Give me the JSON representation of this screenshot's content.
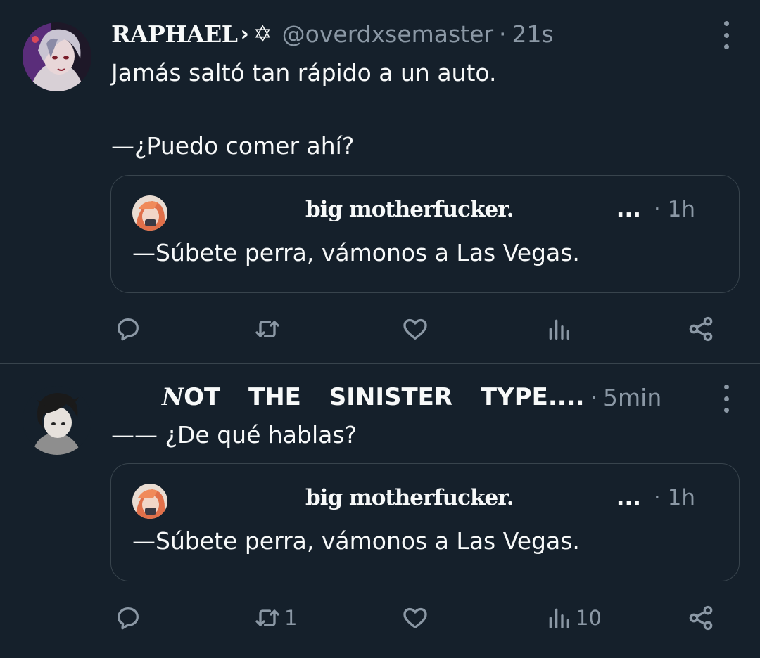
{
  "tweets": [
    {
      "author_name": "RAPHAEL",
      "author_chevron": "›",
      "author_symbol": "✡",
      "handle": "@overdxsemaster",
      "separator": "·",
      "time": "21s",
      "text": "Jamás saltó tan rápido a un auto.\n\n—¿Puedo comer ahí?",
      "quote": {
        "author_name": "big motherfucker.",
        "ellipsis": "...",
        "separator": "·",
        "time": "1h",
        "text": "—Súbete perra, vámonos a Las Vegas."
      },
      "actions": {
        "replies": "",
        "retweets": "",
        "likes": "",
        "views": ""
      }
    },
    {
      "author_name_first": "N",
      "author_name_rest": "OT THE SINISTER TYPE....",
      "separator": "·",
      "time": "5min",
      "text": "—— ¿De qué hablas?",
      "quote": {
        "author_name": "big motherfucker.",
        "ellipsis": "...",
        "separator": "·",
        "time": "1h",
        "text": "—Súbete perra, vámonos a Las Vegas."
      },
      "actions": {
        "replies": "",
        "retweets": "1",
        "likes": "",
        "views": "10"
      }
    }
  ],
  "icons": {
    "reply": "reply-icon",
    "retweet": "retweet-icon",
    "like": "heart-icon",
    "views": "analytics-icon",
    "share": "share-icon",
    "more": "more-icon"
  },
  "colors": {
    "background": "#15202b",
    "text": "#f7f9f9",
    "muted": "#8b98a5",
    "border": "#38444d"
  }
}
